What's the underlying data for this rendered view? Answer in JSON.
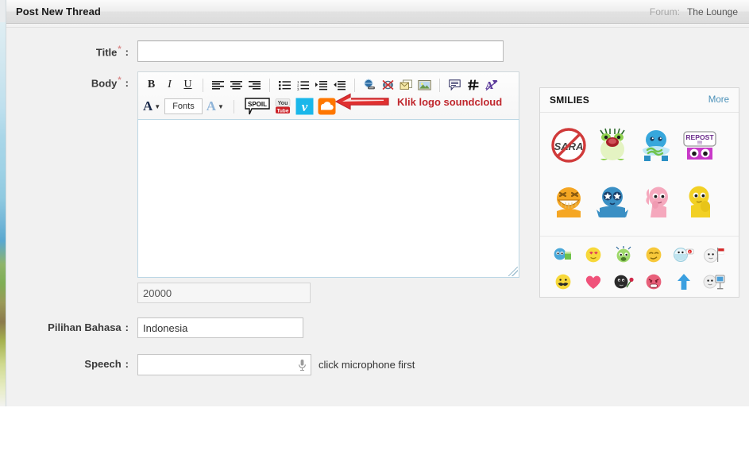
{
  "titlebar": {
    "title": "Post New Thread",
    "forum_label": "Forum:",
    "forum_name": "The Lounge"
  },
  "form": {
    "title_row": {
      "label": "Title",
      "required_mark": "*",
      "colon": ":",
      "value": "",
      "placeholder": ""
    },
    "body_row": {
      "label": "Body",
      "required_mark": "*",
      "colon": ":",
      "value": ""
    },
    "char_counter": "20000",
    "language_row": {
      "label": "Pilihan Bahasa",
      "colon": ":",
      "value": "Indonesia"
    },
    "speech_row": {
      "label": "Speech",
      "colon": ":",
      "value": "",
      "hint": "click microphone first",
      "mic_icon": "microphone-icon"
    }
  },
  "toolbar": {
    "row1": [
      {
        "name": "bold-button",
        "label": "B",
        "icon": "bold-icon"
      },
      {
        "name": "italic-button",
        "label": "I",
        "icon": "italic-icon"
      },
      {
        "name": "underline-button",
        "label": "U",
        "icon": "underline-icon"
      },
      {
        "name": "align-left-button",
        "icon": "align-left-icon"
      },
      {
        "name": "align-center-button",
        "icon": "align-center-icon"
      },
      {
        "name": "align-right-button",
        "icon": "align-right-icon"
      },
      {
        "name": "bullet-list-button",
        "icon": "bullet-list-icon"
      },
      {
        "name": "numbered-list-button",
        "icon": "numbered-list-icon"
      },
      {
        "name": "indent-button",
        "icon": "indent-icon"
      },
      {
        "name": "outdent-button",
        "icon": "outdent-icon"
      },
      {
        "name": "insert-link-button",
        "icon": "globe-link-icon"
      },
      {
        "name": "remove-link-button",
        "icon": "broken-link-icon"
      },
      {
        "name": "insert-email-button",
        "icon": "email-icon"
      },
      {
        "name": "insert-image-button",
        "icon": "image-icon"
      },
      {
        "name": "insert-quote-button",
        "icon": "quote-icon"
      },
      {
        "name": "insert-code-button",
        "icon": "hash-icon"
      },
      {
        "name": "remove-format-button",
        "icon": "remove-format-icon"
      }
    ],
    "row2": [
      {
        "name": "font-color-button",
        "label": "A",
        "icon": "font-color-icon"
      },
      {
        "name": "fonts-dropdown",
        "label": "Fonts",
        "icon": "fonts-dropdown-icon"
      },
      {
        "name": "font-size-button",
        "label": "A",
        "icon": "font-size-icon"
      },
      {
        "name": "spoiler-button",
        "label": "SPOIL",
        "icon": "spoiler-icon"
      },
      {
        "name": "youtube-button",
        "label": "You",
        "sublabel": "Tube",
        "icon": "youtube-icon"
      },
      {
        "name": "vimeo-button",
        "label": "v",
        "icon": "vimeo-icon"
      },
      {
        "name": "soundcloud-button",
        "icon": "soundcloud-icon"
      }
    ]
  },
  "annotation": {
    "arrow_icon": "red-left-arrow-icon",
    "text": "Klik logo soundcloud",
    "color": "#c0272d"
  },
  "smilies": {
    "title": "SMILIES",
    "more_label": "More",
    "big": [
      {
        "name": "smiley-no-sara",
        "label": "SARA"
      },
      {
        "name": "smiley-green-frog",
        "label": ""
      },
      {
        "name": "smiley-blue-creature",
        "label": ""
      },
      {
        "name": "smiley-repost",
        "label": "REPOST"
      }
    ],
    "big_row2": [
      {
        "name": "smiley-orange-grin",
        "label": ""
      },
      {
        "name": "smiley-blue-stareyes",
        "label": ""
      },
      {
        "name": "smiley-pink-thinking",
        "label": ""
      },
      {
        "name": "smiley-yellow-shy",
        "label": ""
      }
    ],
    "small_row1": [
      {
        "name": "smiley-blue-drink"
      },
      {
        "name": "smiley-yellow-inlove"
      },
      {
        "name": "smiley-green-sick"
      },
      {
        "name": "smiley-yellow-smug"
      },
      {
        "name": "smiley-mask-alert"
      },
      {
        "name": "smiley-flag-indonesia"
      }
    ],
    "small_row2": [
      {
        "name": "smiley-yellow-mustache"
      },
      {
        "name": "smiley-pink-heart"
      },
      {
        "name": "smiley-black-rose"
      },
      {
        "name": "smiley-red-angry"
      },
      {
        "name": "smiley-blue-uparrow"
      },
      {
        "name": "smiley-tv-screen"
      }
    ]
  },
  "colors": {
    "accent_red": "#c0272d",
    "link_blue": "#4a90b8",
    "panel_bg": "#fafafa",
    "page_bg": "#f1f1f1"
  }
}
